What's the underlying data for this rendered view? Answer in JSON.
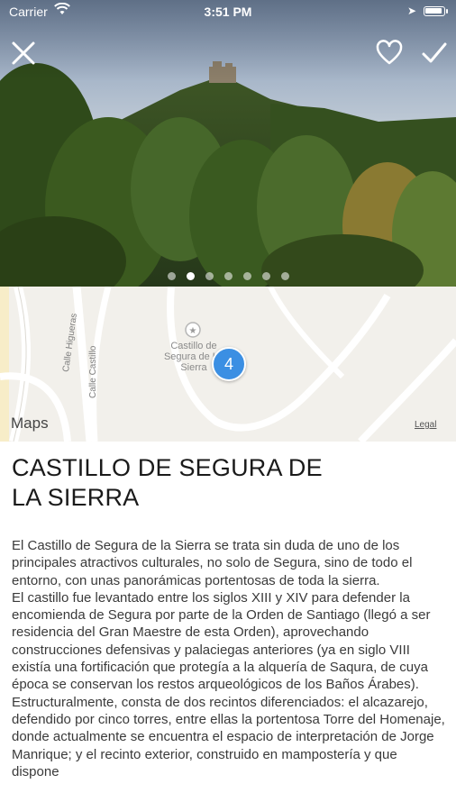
{
  "status_bar": {
    "carrier": "Carrier",
    "time": "3:51 PM",
    "battery_level": 0.9
  },
  "hero": {
    "image_subject": "castle-on-forested-hill",
    "pager": {
      "count": 7,
      "active_index": 1
    }
  },
  "toolbar": {
    "close_icon": "close-icon",
    "favorite_icon": "heart-outline-icon",
    "done_icon": "checkmark-icon"
  },
  "map": {
    "poi_label": "Castillo de Segura de La Sierra",
    "cluster_count": "4",
    "streets": [
      "Calle Higueras",
      "Calle Castillo"
    ],
    "logo": "Maps",
    "legal": "Legal",
    "cluster_color": "#3b8fe3"
  },
  "place": {
    "title": "CASTILLO DE SEGURA DE LA SIERRA",
    "description": "El Castillo de Segura de la Sierra se trata sin duda de uno de los principales atractivos culturales, no solo de Segura, sino de todo el entorno, con unas panorámicas portentosas de toda la sierra.\nEl castillo fue levantado entre los siglos XIII y XIV para defender la encomienda de Segura por parte de la Orden de Santiago (llegó a ser residencia del Gran Maestre de esta Orden), aprovechando construcciones defensivas y palaciegas anteriores (ya en siglo VIII existía una fortificación que protegía a la alquería de Saqura, de cuya época se conservan los restos arqueológicos de los Baños Árabes). Estructuralmente, consta de dos recintos diferenciados: el alcazarejo, defendido por cinco torres, entre ellas la portentosa Torre del Homenaje, donde actualmente se encuentra el espacio de interpretación de Jorge Manrique; y el recinto exterior, construido en mampostería y que dispone"
  }
}
